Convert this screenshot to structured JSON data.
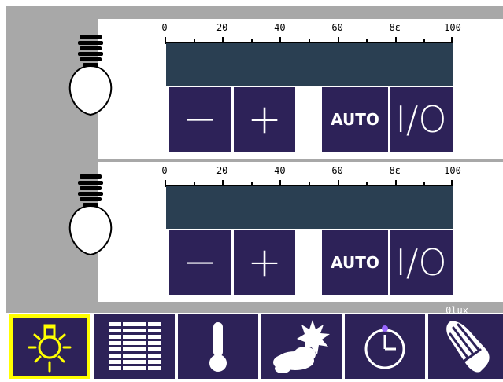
{
  "colors": {
    "frame": "#a8a8a8",
    "button": "#2d2258",
    "bar": "#2a3f52",
    "active_border": "#ffff00",
    "active_icon": "#ffff00",
    "icon": "#ffffff"
  },
  "scale": {
    "labels": [
      "0",
      "20",
      "40",
      "60",
      "8ε",
      "100"
    ]
  },
  "scale_2": {
    "labels": [
      "0",
      "20",
      "40",
      "60",
      "8ε",
      "100"
    ]
  },
  "channels": [
    {
      "level_fraction": 0.0,
      "minus_label": "−",
      "plus_label": "+",
      "auto_label": "AUTO",
      "power_label": "I/O"
    },
    {
      "level_fraction": 0.0,
      "minus_label": "−",
      "plus_label": "+",
      "auto_label": "AUTO",
      "power_label": "I/O"
    }
  ],
  "status": {
    "lux": "0lux"
  },
  "tabs": [
    {
      "icon": "light-bulb-icon",
      "active": true
    },
    {
      "icon": "blinds-icon",
      "active": false
    },
    {
      "icon": "thermometer-icon",
      "active": false
    },
    {
      "icon": "weather-icon",
      "active": false
    },
    {
      "icon": "clock-icon",
      "active": false
    },
    {
      "icon": "cleaning-hand-icon",
      "active": false
    }
  ]
}
